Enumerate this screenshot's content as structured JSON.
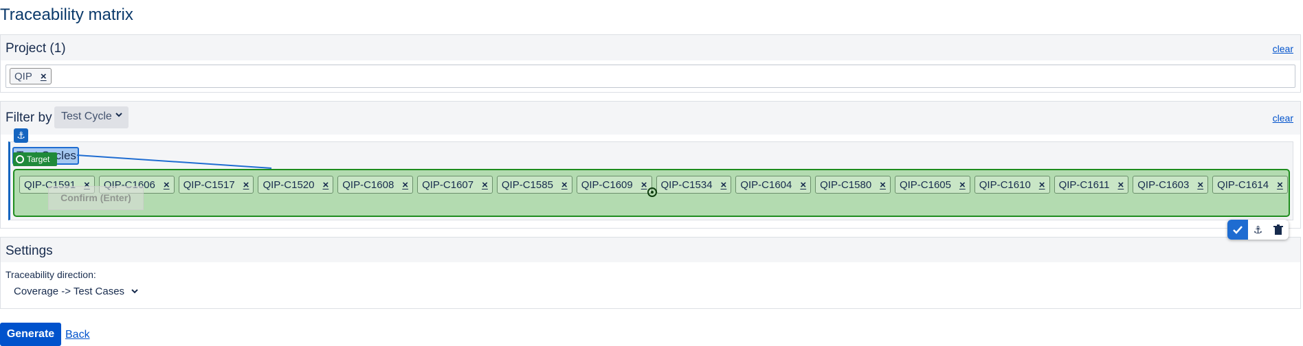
{
  "page": {
    "title": "Traceability matrix"
  },
  "project": {
    "title": "Project (1)",
    "clear_label": "clear",
    "tags": [
      "QIP"
    ],
    "remove_glyph": "×"
  },
  "filter": {
    "label": "Filter by",
    "selected": "Test Cycle",
    "clear_label": "clear",
    "section_label": "Test Cycles",
    "tags": [
      "QIP-C1591",
      "QIP-C1606",
      "QIP-C1517",
      "QIP-C1520",
      "QIP-C1608",
      "QIP-C1607",
      "QIP-C1585",
      "QIP-C1609",
      "QIP-C1534",
      "QIP-C1604",
      "QIP-C1580",
      "QIP-C1605",
      "QIP-C1610",
      "QIP-C1611",
      "QIP-C1603",
      "QIP-C1614"
    ],
    "remove_glyph": "×"
  },
  "overlay": {
    "target_label": "Target",
    "confirm_label": "Confirm (Enter)",
    "icons": [
      "anchor-icon",
      "check-icon",
      "trash-icon",
      "crosshair-icon"
    ]
  },
  "settings": {
    "title": "Settings",
    "direction_label": "Traceability direction:",
    "direction_value": "Coverage -> Test Cases"
  },
  "actions": {
    "generate_label": "Generate",
    "back_label": "Back"
  },
  "colors": {
    "primary": "#0052cc",
    "overlay_green": "#b3dbb0",
    "overlay_border": "#1e8c1e",
    "anchor_blue": "#1565c0"
  }
}
